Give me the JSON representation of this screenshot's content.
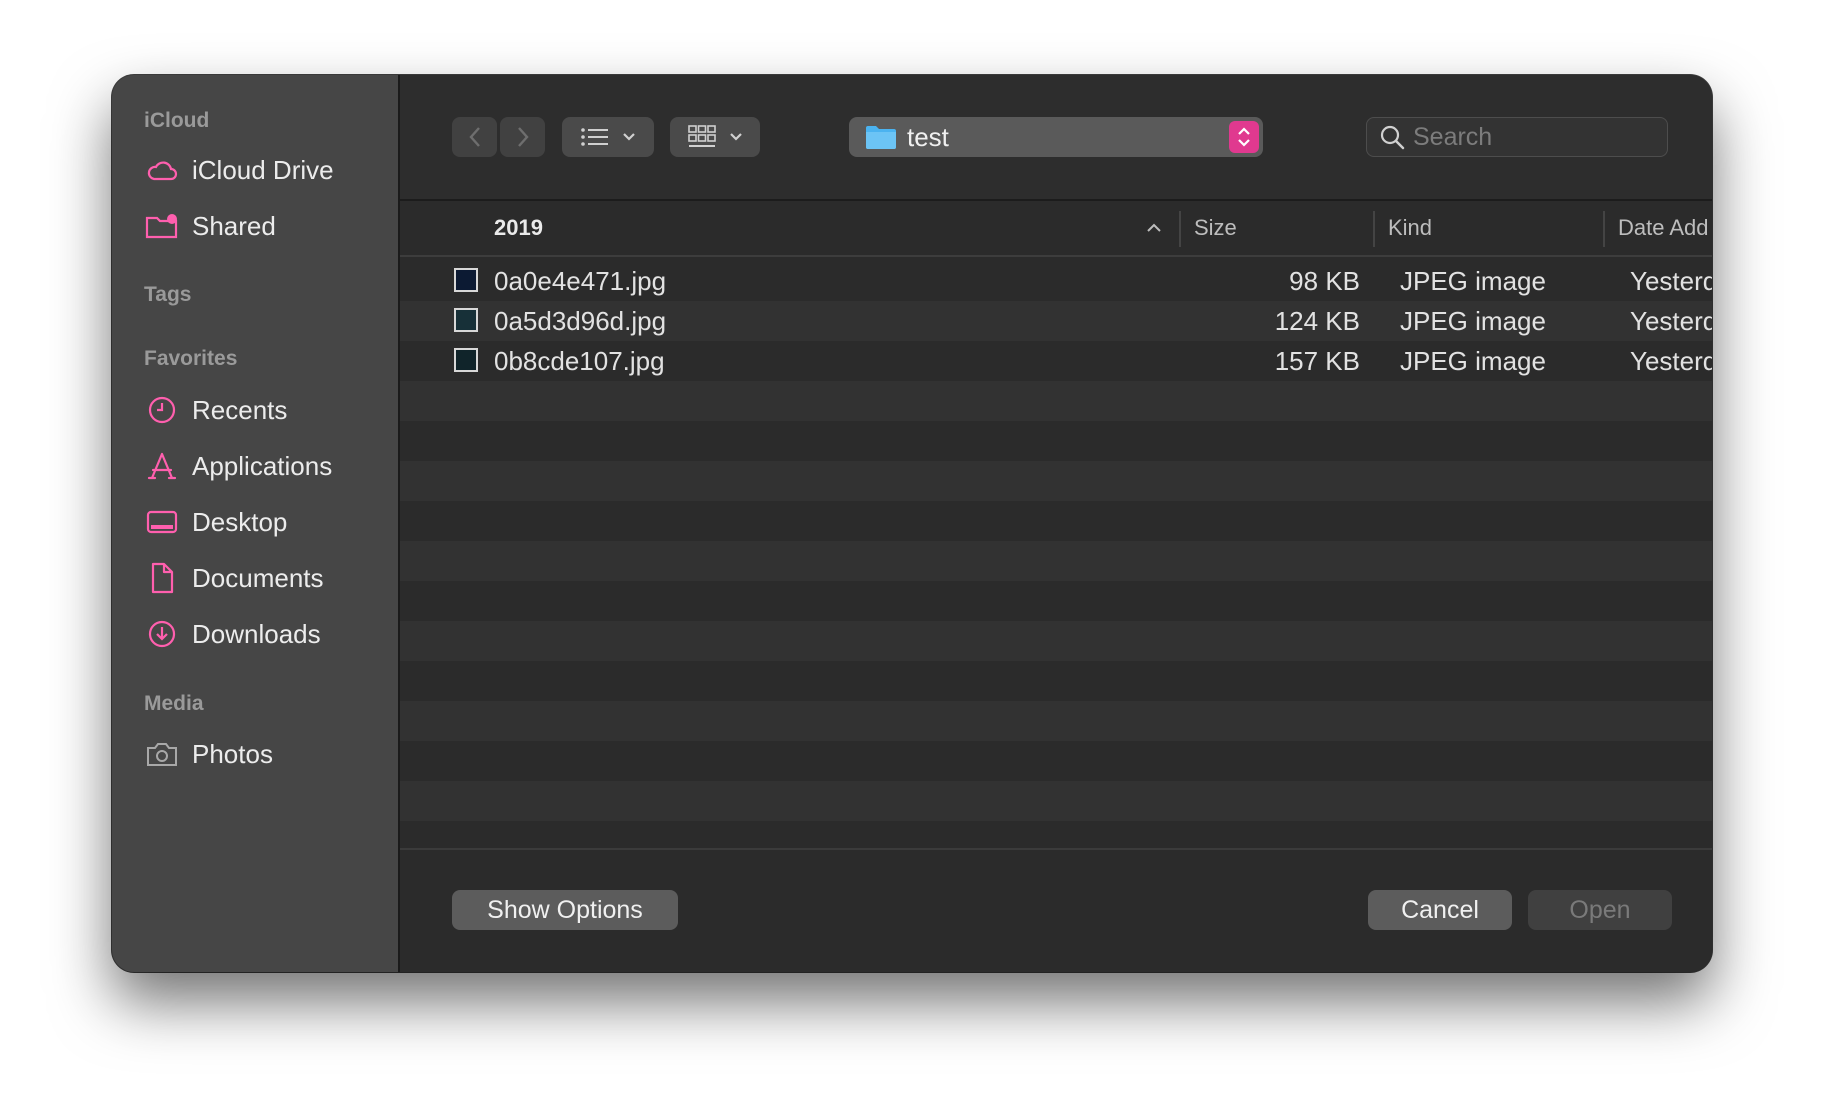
{
  "sidebar": {
    "sections": [
      {
        "heading": "iCloud",
        "items": [
          {
            "label": "iCloud Drive",
            "icon": "cloud-icon"
          },
          {
            "label": "Shared",
            "icon": "shared-folder-icon"
          }
        ]
      },
      {
        "heading": "Tags",
        "items": []
      },
      {
        "heading": "Favorites",
        "items": [
          {
            "label": "Recents",
            "icon": "clock-icon"
          },
          {
            "label": "Applications",
            "icon": "applications-icon"
          },
          {
            "label": "Desktop",
            "icon": "desktop-icon"
          },
          {
            "label": "Documents",
            "icon": "document-icon"
          },
          {
            "label": "Downloads",
            "icon": "download-icon"
          }
        ]
      },
      {
        "heading": "Media",
        "items": [
          {
            "label": "Photos",
            "icon": "camera-icon"
          }
        ]
      }
    ]
  },
  "toolbar": {
    "back_icon": "chevron-left-icon",
    "forward_icon": "chevron-right-icon",
    "list_view_icon": "list-view-icon",
    "group_icon": "grid-view-icon",
    "location": "test",
    "search_placeholder": "Search"
  },
  "columns": {
    "name": "2019",
    "size": "Size",
    "kind": "Kind",
    "date_added": "Date Add"
  },
  "files": [
    {
      "name": "0a0e4e471.jpg",
      "size": "98 KB",
      "kind": "JPEG image",
      "date_added": "Yesterda"
    },
    {
      "name": "0a5d3d96d.jpg",
      "size": "124 KB",
      "kind": "JPEG image",
      "date_added": "Yesterda"
    },
    {
      "name": "0b8cde107.jpg",
      "size": "157 KB",
      "kind": "JPEG image",
      "date_added": "Yesterda"
    }
  ],
  "buttons": {
    "show_options": "Show Options",
    "cancel": "Cancel",
    "open": "Open"
  },
  "colors": {
    "accent": "#e0398f",
    "sidebar_icon": "#ff5fae",
    "folder": "#4bb3f0"
  }
}
